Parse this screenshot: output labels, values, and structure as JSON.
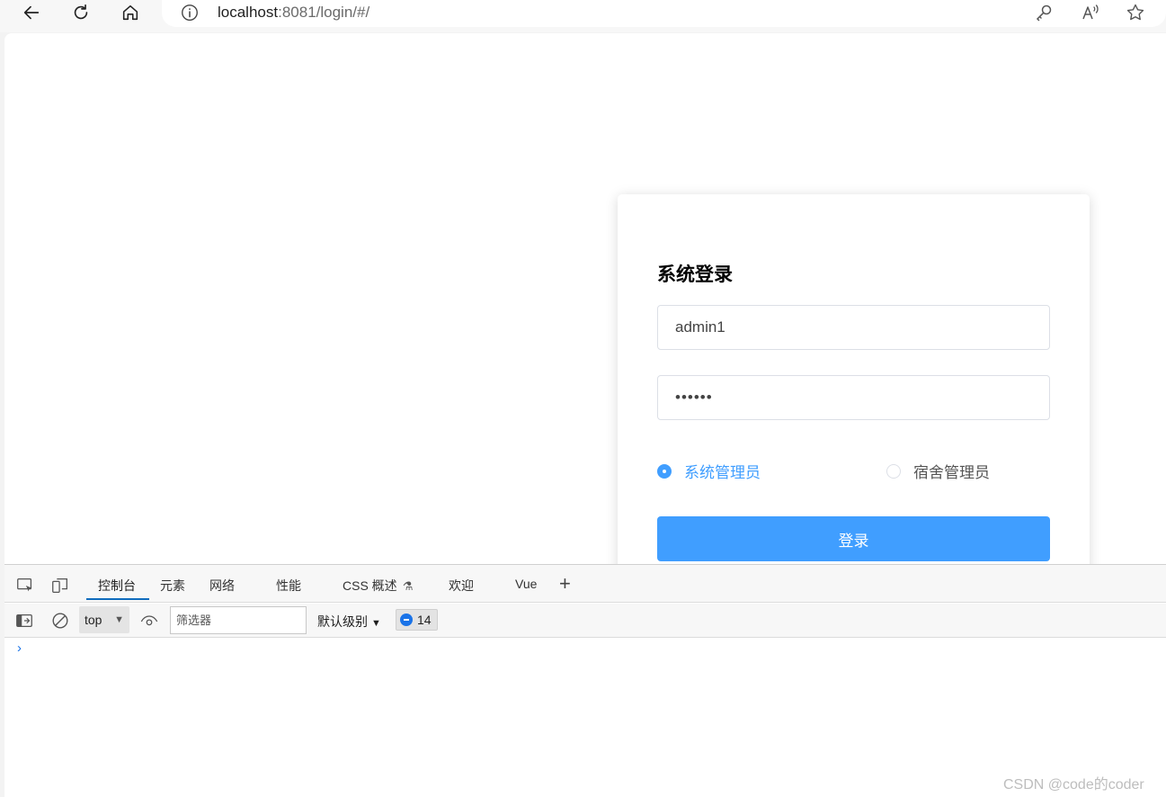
{
  "browser": {
    "url_host": "localhost",
    "url_rest": ":8081/login/#/"
  },
  "login": {
    "title": "系统登录",
    "username": "admin1",
    "password_masked": "••••••",
    "roles": [
      {
        "label": "系统管理员",
        "selected": true
      },
      {
        "label": "宿舍管理员",
        "selected": false
      }
    ],
    "submit_label": "登录",
    "accent_color": "#409eff"
  },
  "devtools": {
    "tabs": [
      {
        "label": "控制台",
        "active": true
      },
      {
        "label": "元素",
        "active": false
      },
      {
        "label": "网络",
        "active": false
      },
      {
        "label": "性能",
        "active": false
      },
      {
        "label": "CSS 概述",
        "active": false
      },
      {
        "label": "欢迎",
        "active": false
      },
      {
        "label": "Vue",
        "active": false
      }
    ],
    "context": "top",
    "filter_placeholder": "筛选器",
    "levels": "默认级别",
    "message_count": "14",
    "prompt": "›"
  },
  "watermark": "CSDN @code的coder"
}
